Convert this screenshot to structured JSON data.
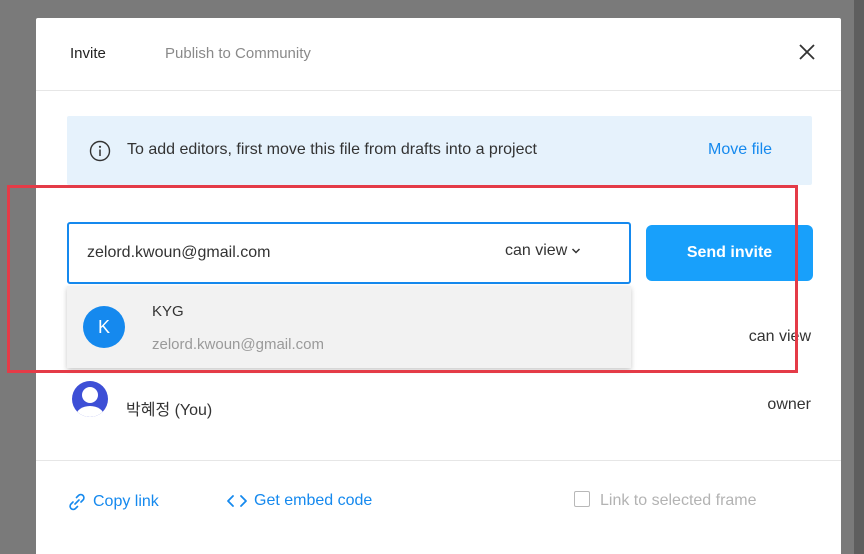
{
  "tabs": {
    "invite": "Invite",
    "publish": "Publish to Community"
  },
  "banner": {
    "text": "To add editors, first move this file from drafts into a project",
    "action": "Move file"
  },
  "invite_form": {
    "email_value": "zelord.kwoun@gmail.com",
    "permission": "can view",
    "send_label": "Send invite"
  },
  "suggestion": {
    "initial": "K",
    "name": "KYG",
    "email": "zelord.kwoun@gmail.com"
  },
  "members": [
    {
      "permission": "can view"
    },
    {
      "name": "박혜정 (You)",
      "permission": "owner"
    }
  ],
  "footer": {
    "copy_link": "Copy link",
    "embed": "Get embed code",
    "link_frame": "Link to selected frame"
  },
  "colors": {
    "accent": "#18a0fb",
    "highlight": "#e43b47",
    "banner_bg": "#e6f2fc"
  }
}
